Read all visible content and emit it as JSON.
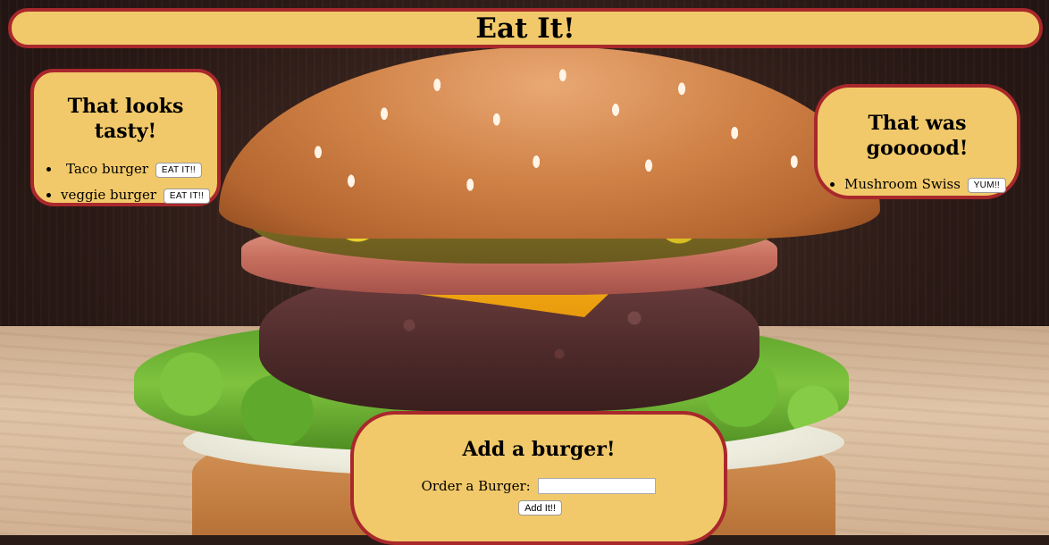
{
  "header": {
    "title": "Eat It!"
  },
  "tasty": {
    "heading": "That looks tasty!",
    "items": [
      {
        "name": "Taco burger",
        "button": "EAT IT!!"
      },
      {
        "name": "veggie burger",
        "button": "EAT IT!!"
      }
    ]
  },
  "devoured": {
    "heading": "That was goooood!",
    "items": [
      {
        "name": "Mushroom Swiss",
        "button": "YUM!!"
      }
    ]
  },
  "add_form": {
    "heading": "Add a burger!",
    "label": "Order a Burger:",
    "input_value": "",
    "submit_label": "Add It!!"
  },
  "colors": {
    "panel_bg": "#f2c96a",
    "panel_border": "#a8282c"
  }
}
